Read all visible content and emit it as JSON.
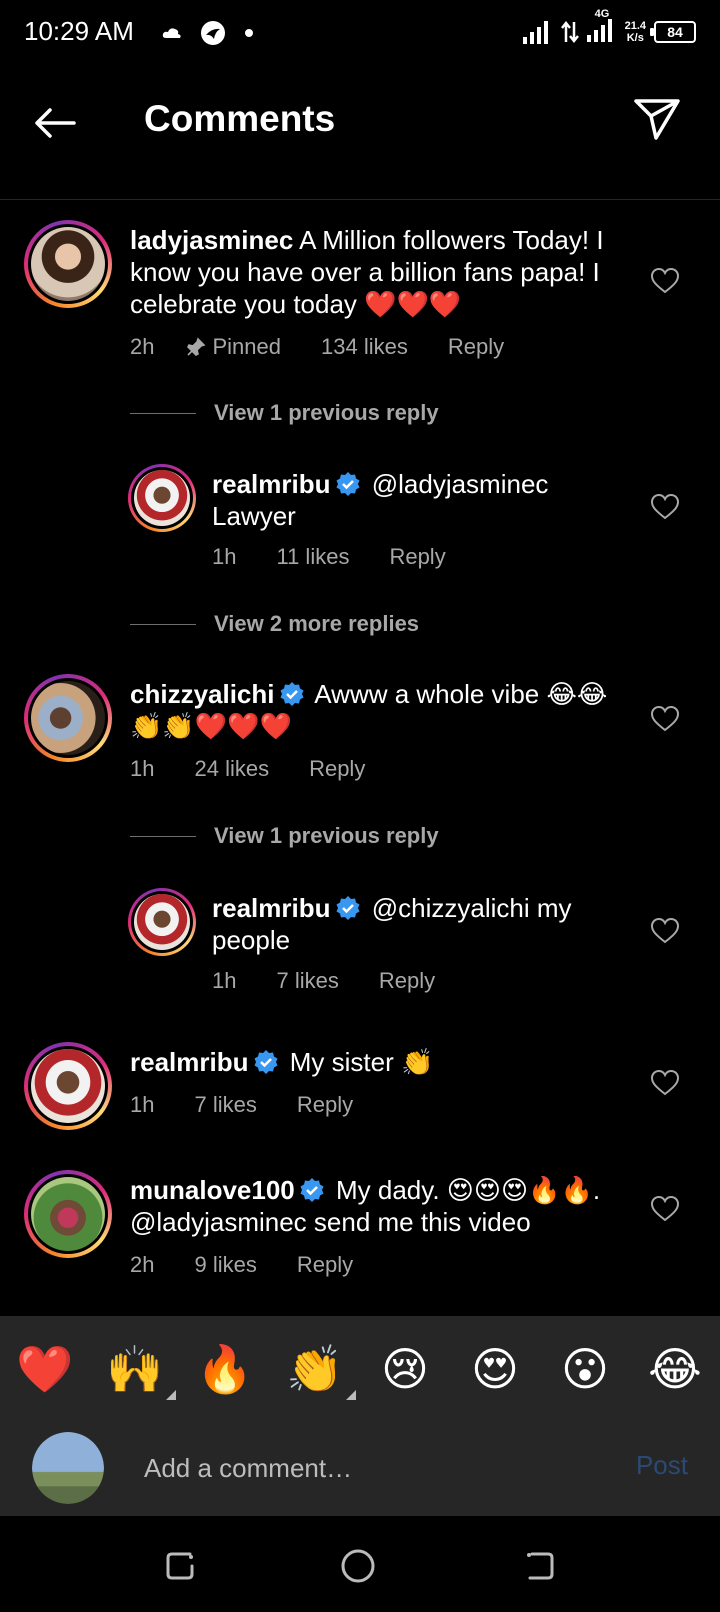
{
  "status": {
    "time": "10:29 AM",
    "network": "4G",
    "speed_top": "21.4",
    "speed_bottom": "K/s",
    "battery": "84"
  },
  "header": {
    "title": "Comments"
  },
  "comments": [
    {
      "username": "ladyjasminec",
      "text": "A Million followers Today! I know you have over a billion fans papa! I celebrate you today ❤️❤️❤️",
      "time": "2h",
      "pinned": "Pinned",
      "likes": "134 likes",
      "reply": "Reply"
    },
    {
      "view_label": "View 1 previous reply"
    },
    {
      "username": "realmribu",
      "text": "@ladyjasminec Lawyer",
      "time": "1h",
      "likes": "11 likes",
      "reply": "Reply"
    },
    {
      "view_label": "View 2 more replies"
    },
    {
      "username": "chizzyalichi",
      "text": "Awww a whole vibe 😂😂👏👏❤️❤️❤️",
      "time": "1h",
      "likes": "24 likes",
      "reply": "Reply"
    },
    {
      "view_label": "View 1 previous reply"
    },
    {
      "username": "realmribu",
      "text": "@chizzyalichi my people",
      "time": "1h",
      "likes": "7 likes",
      "reply": "Reply"
    },
    {
      "username": "realmribu",
      "text": "My sister 👏",
      "time": "1h",
      "likes": "7 likes",
      "reply": "Reply"
    },
    {
      "username": "munalove100",
      "text": "My dady. 😍😍😍🔥🔥. @ladyjasminec send me this video",
      "time": "2h",
      "likes": "9 likes",
      "reply": "Reply"
    }
  ],
  "emojis": [
    "❤️",
    "🙌",
    "🔥",
    "👏",
    "😢",
    "😍",
    "😮",
    "😂"
  ],
  "composer": {
    "placeholder": "Add a comment…",
    "post_label": "Post"
  },
  "colors": {
    "background": "#000000",
    "muted_text": "#a8a8a8",
    "verified": "#3897f0",
    "post_disabled": "#2b4a73"
  }
}
